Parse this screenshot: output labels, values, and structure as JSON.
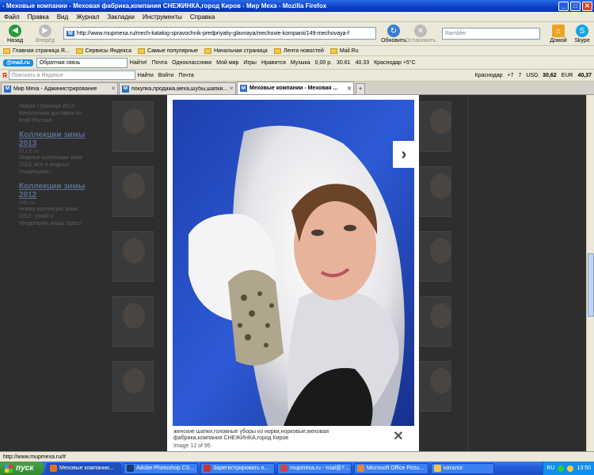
{
  "window": {
    "title": "- Меховые компании - Меховая фабрика,компания СНЕЖИНКА,город Киров - Мир Меха - Mozilla Firefox"
  },
  "menu": [
    "Файл",
    "Правка",
    "Вид",
    "Журнал",
    "Закладки",
    "Инструменты",
    "Справка"
  ],
  "nav": {
    "back": "Назад",
    "forward": "Вперёд",
    "url": "http://www.mupmexa.ru/mech-katalog-spravochnik-predpriyatiy-glavnaya/mechovie-kompanii/149-mechovaya-f",
    "refresh": "Обновить",
    "stop": "Остановить",
    "search_placeholder": "Rambler",
    "home": "Домой",
    "skype": "Skype"
  },
  "bookmarks": [
    "Главная страница Я...",
    "Сервисы Яндекса",
    "Самые популярные",
    "Начальная страница",
    "Лента новостей",
    "Mail.Ru"
  ],
  "mailbar": {
    "logo": "@mail.ru",
    "select_value": "Обратная связь",
    "find": "Найти!",
    "items": [
      "Почта",
      "Одноклассники",
      "Мой мир",
      "Игры",
      "Нравится",
      "Музыка"
    ],
    "rub": "0,00 р.",
    "usd": "30.61",
    "eur": "40.33",
    "weather": "Краснодар +5°C"
  },
  "yabar": {
    "logo": "Я",
    "placeholder": "Поискать в Яндексе",
    "find": "Найти",
    "login": "Войти",
    "mail": "Почта",
    "city": "Краснодар",
    "temp": "+7",
    "rate1": "7",
    "usd_label": "USD",
    "usd": "30,62",
    "eur_label": "EUR",
    "eur": "40,37"
  },
  "tabs": [
    {
      "label": "Мир Меха - Администрирование",
      "active": false
    },
    {
      "label": "покупка,продажа,меха,шубы,шапки...",
      "active": false
    },
    {
      "label": "Меховые компании - Меховая ...",
      "active": true
    }
  ],
  "sidebar": {
    "top_text": [
      "Новая страница 2013",
      "Бесплатная доставка по",
      "всей России!"
    ],
    "blocks": [
      {
        "heading": "Коллекции зимы 2013",
        "source": "ELLE.ru",
        "text": [
          "Модные коллекции зима",
          "2013, все о модных",
          "тенденциях..."
        ]
      },
      {
        "heading": "Коллекции зимы 2012",
        "source": "edlr.ru",
        "text": [
          "Новая коллекция зима",
          "2012: узнай о",
          "тенденциях моды здесь!"
        ]
      }
    ]
  },
  "lightbox": {
    "caption": "женские шапки,головные уборы из норки,норковые,меховая фабрика,компания СНЕЖИНКА,город Киров",
    "counter": "Image 12 of 95",
    "next": "›",
    "close": "✕"
  },
  "status": "http://www.mupmexa.ru/#",
  "taskbar": {
    "start": "пуск",
    "buttons": [
      "Меховые компании...",
      "Adobe Photoshop CS...",
      "Зарегистрировать в...",
      "mupmexa.ru - mial@7...",
      "Microsoft Office Pictu...",
      "каталог"
    ],
    "lang": "RU",
    "clock": "13:50"
  },
  "colors": {
    "titlebar": "#0a3fc3",
    "taskbar": "#245edb",
    "start": "#2f8a2d",
    "overlay": "#2e2e2e"
  }
}
